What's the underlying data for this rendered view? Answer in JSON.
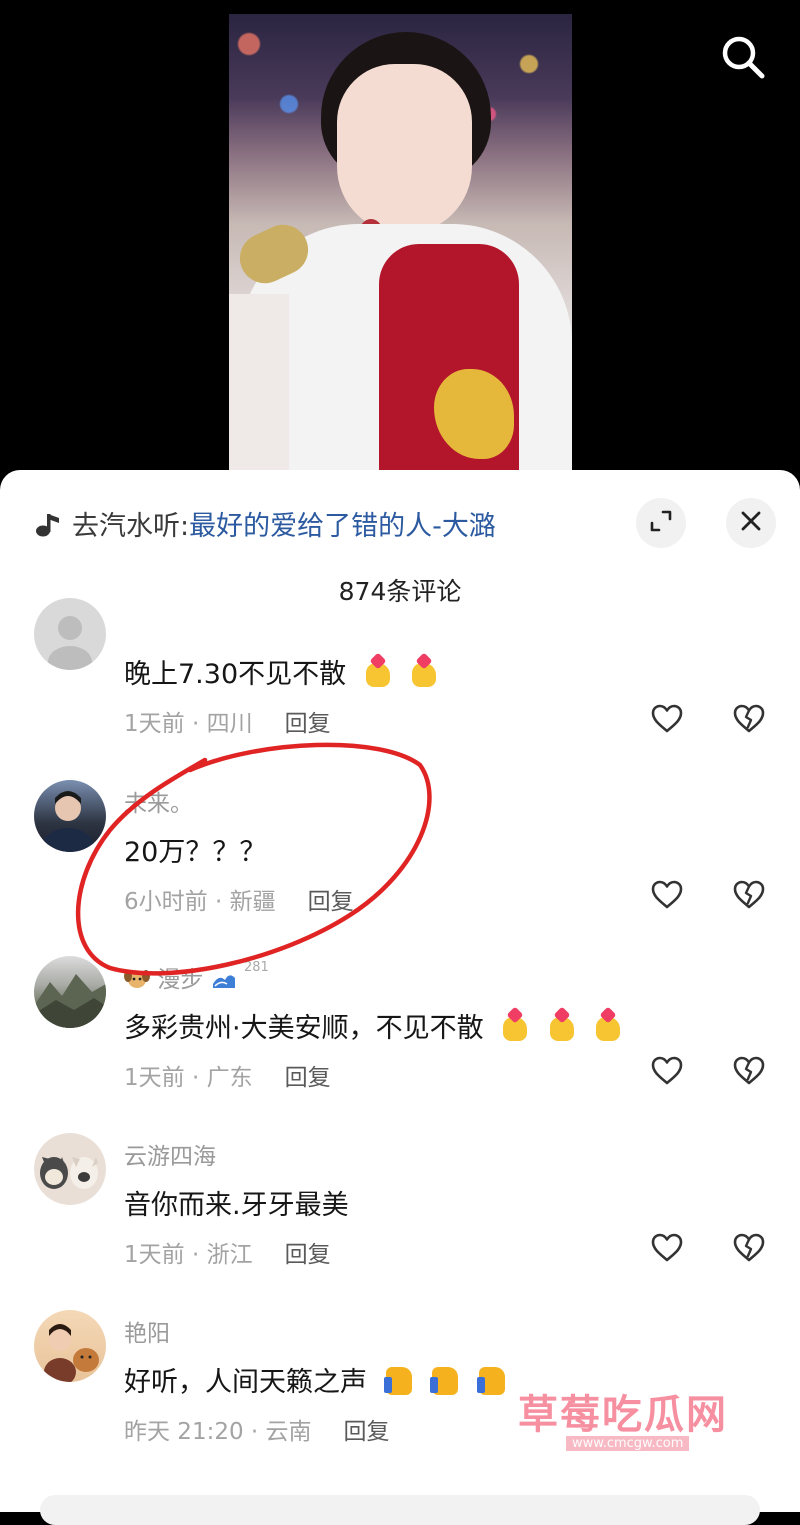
{
  "music": {
    "prefix": "去汽水听:",
    "title": "最好的爱给了错的人-大潞"
  },
  "comment_count": "874条评论",
  "comments": [
    {
      "username": "",
      "text": "晚上7.30不见不散",
      "time": "1天前",
      "location": "四川",
      "reply": "回复",
      "emoji": [
        "finger-heart",
        "finger-heart"
      ]
    },
    {
      "username": "未来。",
      "text": "20万？？？",
      "time": "6小时前",
      "location": "新疆",
      "reply": "回复",
      "emoji": []
    },
    {
      "username": "漫步",
      "badge": "281",
      "text": "多彩贵州·大美安顺，不见不散",
      "time": "1天前",
      "location": "广东",
      "reply": "回复",
      "emoji": [
        "finger-heart",
        "finger-heart",
        "finger-heart"
      ]
    },
    {
      "username": "云游四海",
      "text": "音你而来.牙牙最美",
      "time": "1天前",
      "location": "浙江",
      "reply": "回复",
      "emoji": []
    },
    {
      "username": "艳阳",
      "text": "好听，人间天籁之声",
      "time": "昨天 21:20",
      "location": "云南",
      "reply": "回复",
      "emoji": [
        "thumbs-up",
        "thumbs-up",
        "thumbs-up"
      ]
    }
  ],
  "watermark": {
    "text": "草莓吃瓜网",
    "url": "www.cmcgw.com"
  },
  "icons": {
    "search": "search-icon",
    "music": "music-note-icon",
    "expand": "expand-icon",
    "close": "close-icon",
    "like": "heart-outline-icon",
    "dislike": "broken-heart-icon"
  },
  "colors": {
    "music_title": "#2c5aa0",
    "annotation": "#e02424",
    "background": "#000000",
    "panel": "#ffffff"
  }
}
